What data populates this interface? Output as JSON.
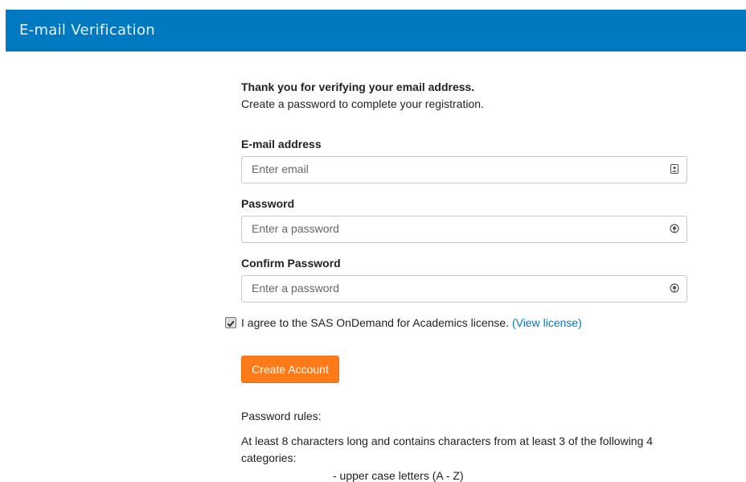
{
  "header": {
    "title": "E-mail Verification",
    "background_color": "#0079c1"
  },
  "intro": {
    "title": "Thank you for verifying your email address.",
    "subtitle": "Create a password to complete your registration."
  },
  "fields": {
    "email": {
      "label": "E-mail address",
      "placeholder": "Enter email",
      "value": "",
      "icon": "contact-card-icon"
    },
    "password": {
      "label": "Password",
      "placeholder": "Enter a password",
      "value": "",
      "icon": "eye-toggle-icon"
    },
    "confirm_password": {
      "label": "Confirm Password",
      "placeholder": "Enter a password",
      "value": "",
      "icon": "eye-toggle-icon"
    }
  },
  "agreement": {
    "checked": true,
    "text": "I agree to the SAS OnDemand for Academics license.",
    "link_text": "(View license)",
    "link_color": "#0079c1"
  },
  "create_button": {
    "label": "Create Account",
    "color": "#ff7a18"
  },
  "rules": {
    "title": "Password rules:",
    "description": "At least 8 characters long and contains characters from at least 3 of the following 4 categories:",
    "partial_line": "- upper case letters (A - Z)"
  }
}
